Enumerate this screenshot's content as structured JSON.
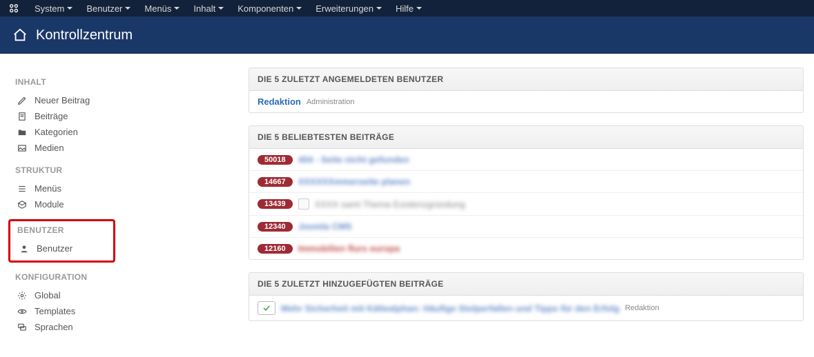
{
  "topnav": {
    "items": [
      "System",
      "Benutzer",
      "Menüs",
      "Inhalt",
      "Komponenten",
      "Erweiterungen",
      "Hilfe"
    ]
  },
  "header": {
    "title": "Kontrollzentrum"
  },
  "sidebar": {
    "inhalt": {
      "heading": "INHALT",
      "items": [
        "Neuer Beitrag",
        "Beiträge",
        "Kategorien",
        "Medien"
      ]
    },
    "struktur": {
      "heading": "STRUKTUR",
      "items": [
        "Menüs",
        "Module"
      ]
    },
    "benutzer": {
      "heading": "BENUTZER",
      "items": [
        "Benutzer"
      ]
    },
    "konfiguration": {
      "heading": "KONFIGURATION",
      "items": [
        "Global",
        "Templates",
        "Sprachen"
      ]
    }
  },
  "panels": {
    "logged": {
      "title": "DIE 5 ZULETZT ANGEMELDETEN BENUTZER",
      "row": {
        "name": "Redaktion",
        "location": "Administration"
      }
    },
    "popular": {
      "title": "DIE 5 BELIEBTESTEN BEITRÄGE",
      "rows": [
        {
          "count": "50018",
          "text": "404 - Seite nicht gefunden"
        },
        {
          "count": "14667",
          "text": "XXXXXXmmerseite planen"
        },
        {
          "count": "13439",
          "text": "XXXX samt Thema Existenzgründung"
        },
        {
          "count": "12340",
          "text": "Joomla CMS"
        },
        {
          "count": "12160",
          "text": "Immobilien flurs europa"
        }
      ]
    },
    "recent": {
      "title": "DIE 5 ZULETZT HINZUGEFÜGTEN BEITRÄGE",
      "row": {
        "text": "Mehr Sicherheit mit Kältealphan: Häufige Stolperfallen und Tipps für den Erfolg",
        "author": "Redaktion"
      }
    }
  }
}
